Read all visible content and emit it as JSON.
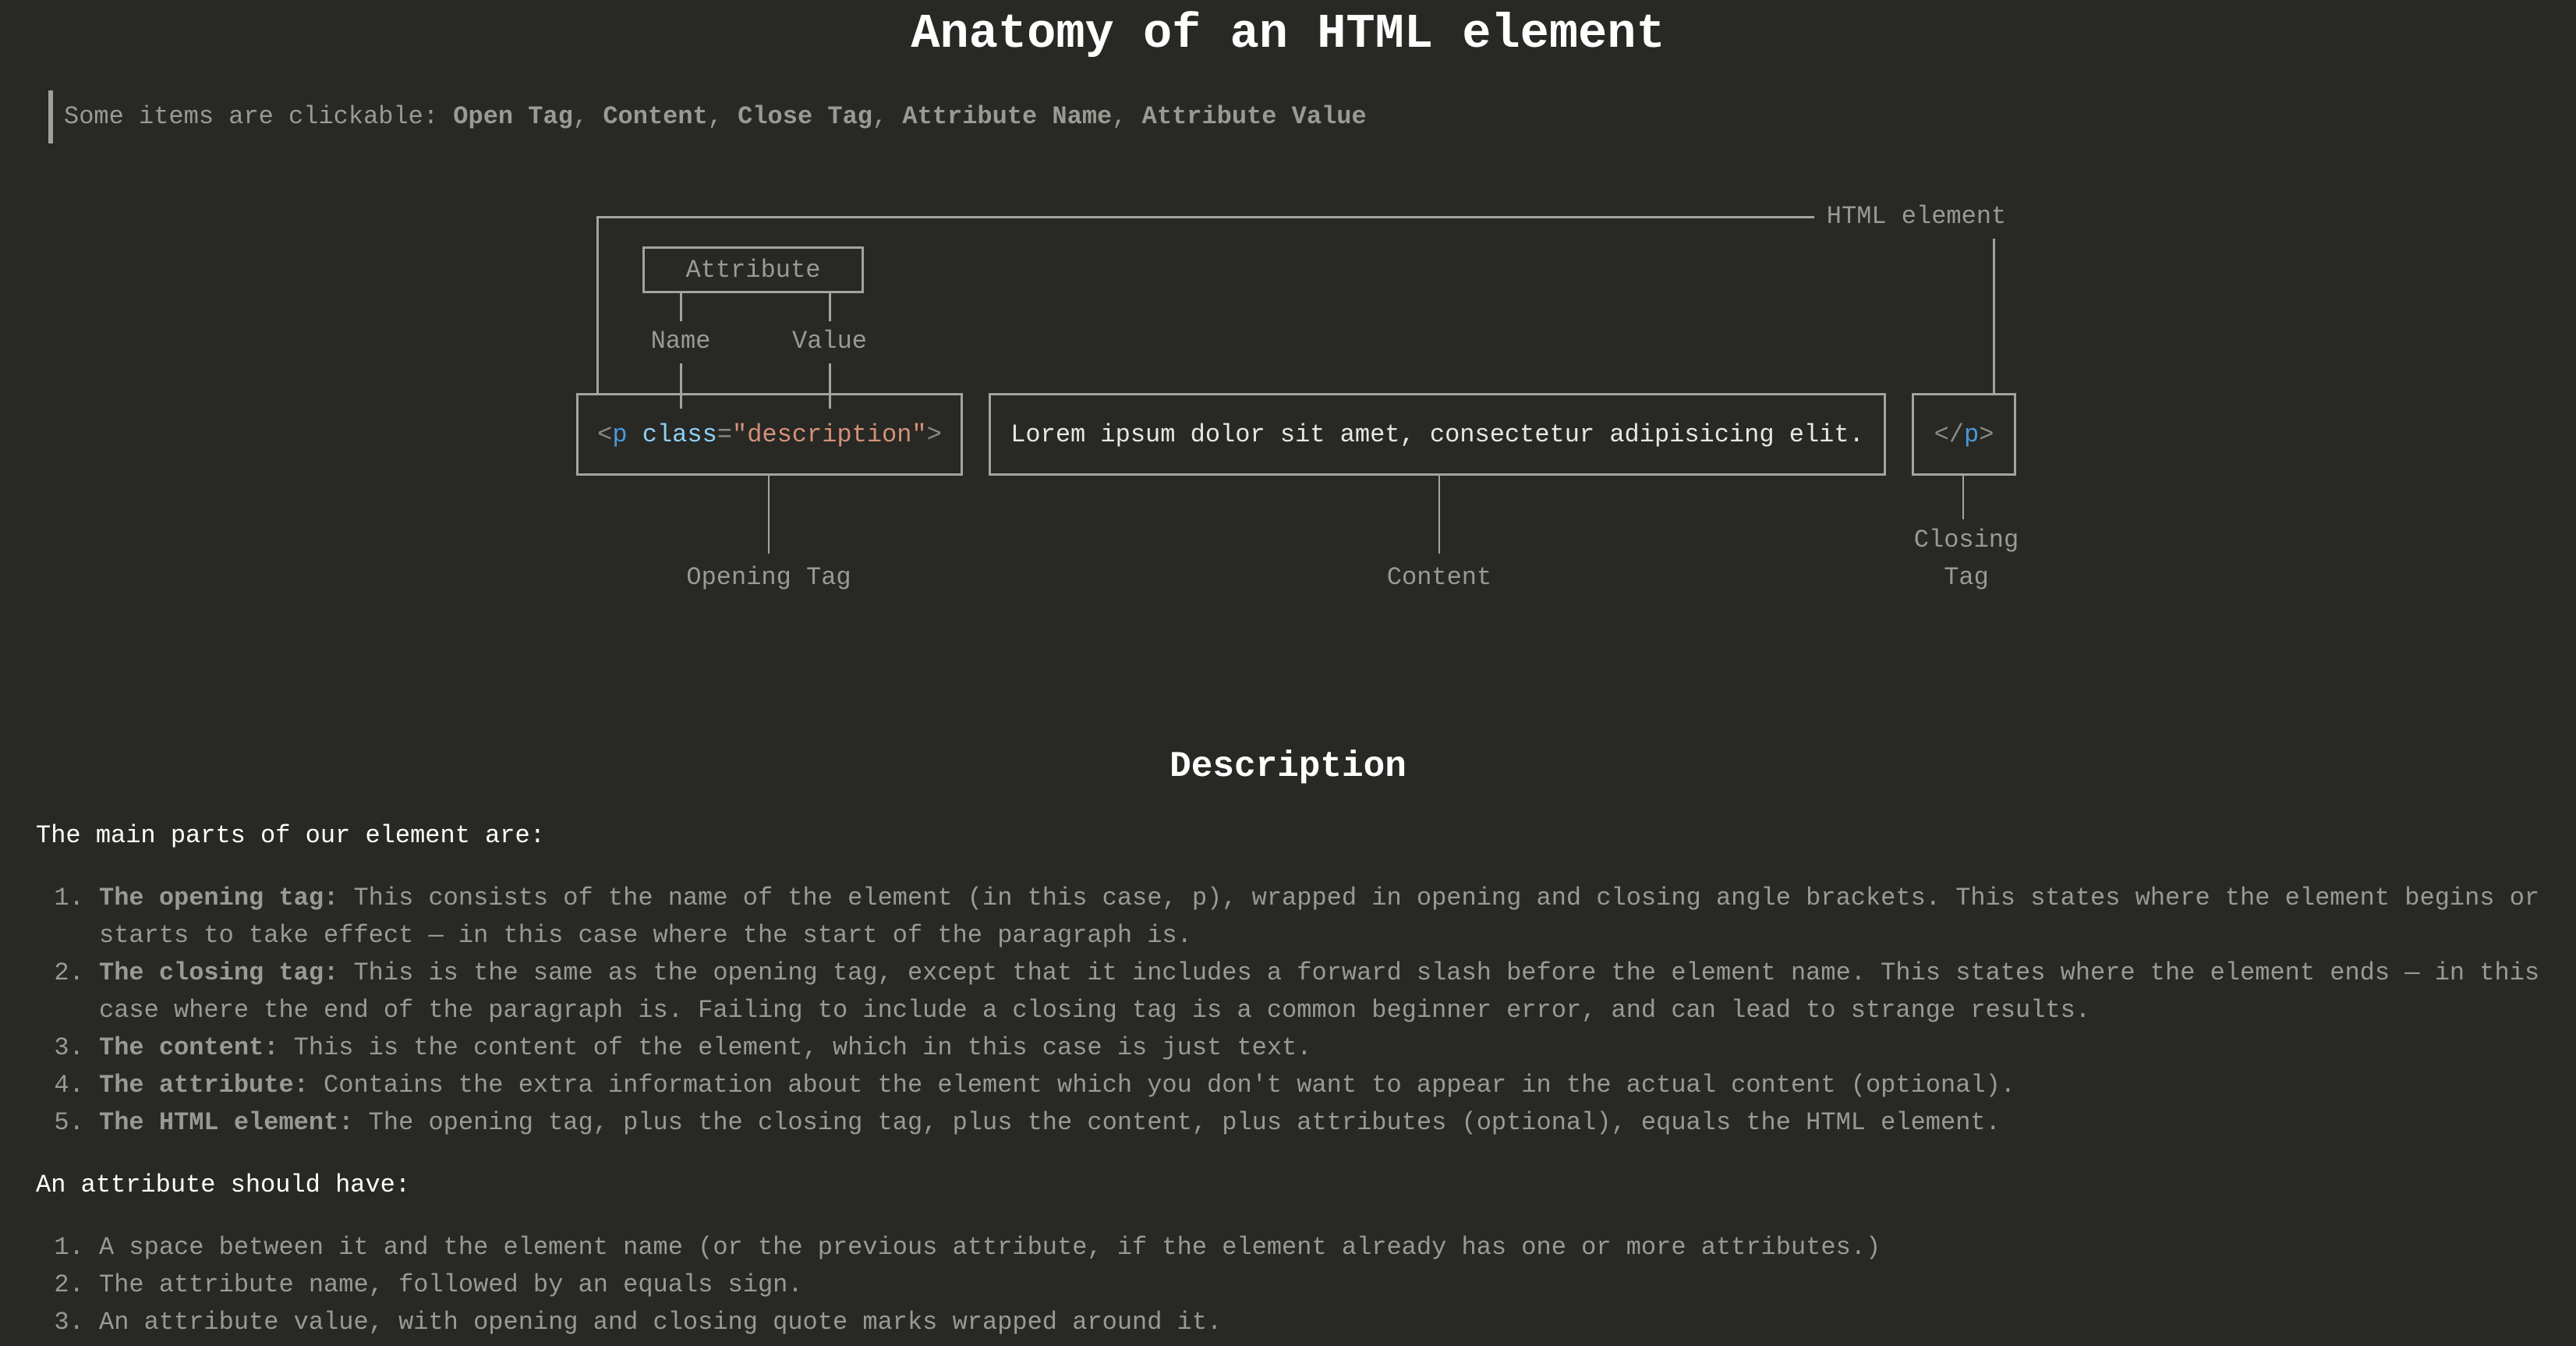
{
  "page": {
    "title": "Anatomy of an HTML element"
  },
  "hint": {
    "prefix": "Some items are clickable: ",
    "items": [
      "Open Tag",
      "Content",
      "Close Tag",
      "Attribute Name",
      "Attribute Value"
    ],
    "separator": ", "
  },
  "diagram": {
    "html_element_label": "HTML element",
    "attribute_label": "Attribute",
    "name_label": "Name",
    "value_label": "Value",
    "opening_tag": {
      "open_bracket": "<",
      "tag": "p",
      "space": " ",
      "attr_name": "class",
      "equals": "=",
      "quote_open": "\"",
      "attr_value": "description",
      "quote_close": "\"",
      "close_bracket": ">"
    },
    "content_text": "Lorem ipsum dolor sit amet, consectetur adipisicing elit.",
    "closing_tag": {
      "open_bracket": "</",
      "tag": "p",
      "close_bracket": ">"
    },
    "opening_tag_label": "Opening Tag",
    "content_label": "Content",
    "closing_tag_label_line1": "Closing",
    "closing_tag_label_line2": "Tag",
    "colors": {
      "tag": "#4a98d6",
      "attr_name": "#8fd0f5",
      "attr_value": "#d49178",
      "punct": "#8a8a86",
      "line": "#a3a3a0"
    }
  },
  "description": {
    "heading": "Description",
    "intro": "The main parts of our element are:",
    "parts": [
      {
        "term": "The opening tag:",
        "text": " This consists of the name of the element (in this case, p), wrapped in opening and closing angle brackets. This states where the element begins or starts to take effect — in this case where the start of the paragraph is."
      },
      {
        "term": "The closing tag:",
        "text": " This is the same as the opening tag, except that it includes a forward slash before the element name. This states where the element ends — in this case where the end of the paragraph is. Failing to include a closing tag is a common beginner error, and can lead to strange results."
      },
      {
        "term": "The content:",
        "text": " This is the content of the element, which in this case is just text."
      },
      {
        "term": "The attribute:",
        "text": " Contains the extra information about the element which you don't want to appear in the actual content (optional)."
      },
      {
        "term": "The HTML element:",
        "text": " The opening tag, plus the closing tag, plus the content, plus attributes (optional), equals the HTML element."
      }
    ],
    "attribute_intro": "An attribute should have:",
    "attribute_rules": [
      "A space between it and the element name (or the previous attribute, if the element already has one or more attributes.)",
      "The attribute name, followed by an equals sign.",
      "An attribute value, with opening and closing quote marks wrapped around it."
    ]
  }
}
